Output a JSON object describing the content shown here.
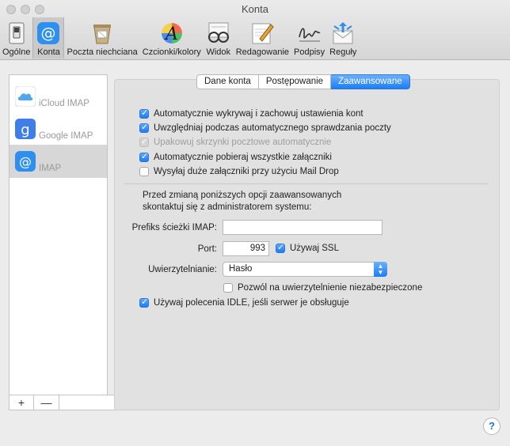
{
  "window": {
    "title": "Konta"
  },
  "toolbar": {
    "items": [
      {
        "label": "Ogólne",
        "icon": "switch-icon"
      },
      {
        "label": "Konta",
        "icon": "at-icon"
      },
      {
        "label": "Poczta niechciana",
        "icon": "junk-trash-icon"
      },
      {
        "label": "Czcionki/kolory",
        "icon": "font-icon"
      },
      {
        "label": "Widok",
        "icon": "glasses-icon"
      },
      {
        "label": "Redagowanie",
        "icon": "compose-icon"
      },
      {
        "label": "Podpisy",
        "icon": "signature-icon"
      },
      {
        "label": "Reguły",
        "icon": "rules-icon"
      }
    ]
  },
  "sidebar": {
    "accounts": [
      {
        "label": "iCloud IMAP",
        "icon": "icloud-icon"
      },
      {
        "label": "Google IMAP",
        "icon": "google-icon"
      },
      {
        "label": "IMAP",
        "icon": "at-icon"
      }
    ],
    "add_label": "+",
    "remove_label": "—"
  },
  "tabs": [
    "Dane konta",
    "Postępowanie",
    "Zaawansowane"
  ],
  "options": [
    {
      "label": "Automatycznie wykrywaj i zachowuj ustawienia kont",
      "checked": true
    },
    {
      "label": "Uwzględniaj podczas automatycznego sprawdzania poczty",
      "checked": true
    },
    {
      "label": "Upakowuj skrzynki pocztowe automatycznie",
      "checked": true,
      "disabled": true
    },
    {
      "label": "Automatycznie pobieraj wszystkie załączniki",
      "checked": true
    },
    {
      "label": "Wysyłaj duże załączniki przy użyciu Mail Drop",
      "checked": false
    }
  ],
  "advanced_note_line1": "Przed zmianą poniższych opcji zaawansowanych",
  "advanced_note_line2": "skontaktuj się z administratorem systemu:",
  "fields": {
    "imap_prefix_label": "Prefiks ścieżki IMAP:",
    "imap_prefix_value": "",
    "port_label": "Port:",
    "port_value": "993",
    "ssl_label": "Używaj SSL",
    "ssl_checked": true,
    "auth_label": "Uwierzytelnianie:",
    "auth_value": "Hasło",
    "insecure_label": "Pozwól na uwierzytelnienie niezabezpieczone",
    "insecure_checked": false,
    "idle_label": "Używaj polecenia IDLE, jeśli serwer je obsługuje",
    "idle_checked": true
  },
  "help_label": "?"
}
